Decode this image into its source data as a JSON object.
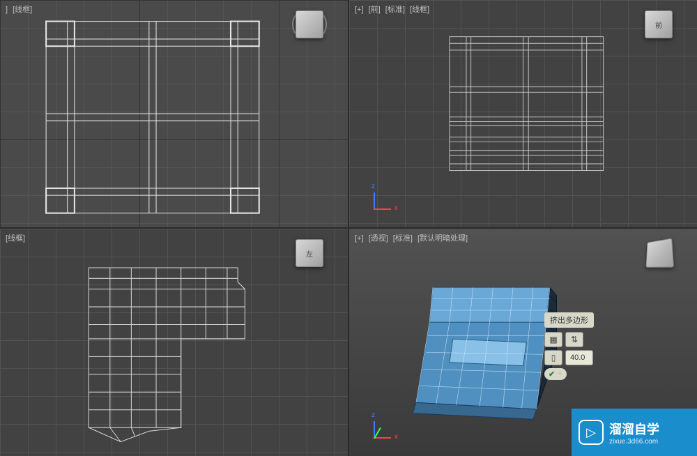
{
  "viewports": {
    "top_left": {
      "labels": [
        "]",
        "[线框]"
      ]
    },
    "top_right": {
      "labels": [
        "[+]",
        "[前]",
        "[标准]",
        "[线框]"
      ],
      "cube_label": "前"
    },
    "bottom_left": {
      "labels": [
        "[线框]"
      ],
      "cube_label": "左"
    },
    "bottom_right": {
      "labels": [
        "[+]",
        "[透视]",
        "[标准]",
        "[默认明暗处理]"
      ],
      "cube_label": ""
    }
  },
  "caddy": {
    "title": "挤出多边形",
    "value": "40.0"
  },
  "watermark": {
    "title": "溜溜自学",
    "url": "zixue.3d66.com"
  }
}
